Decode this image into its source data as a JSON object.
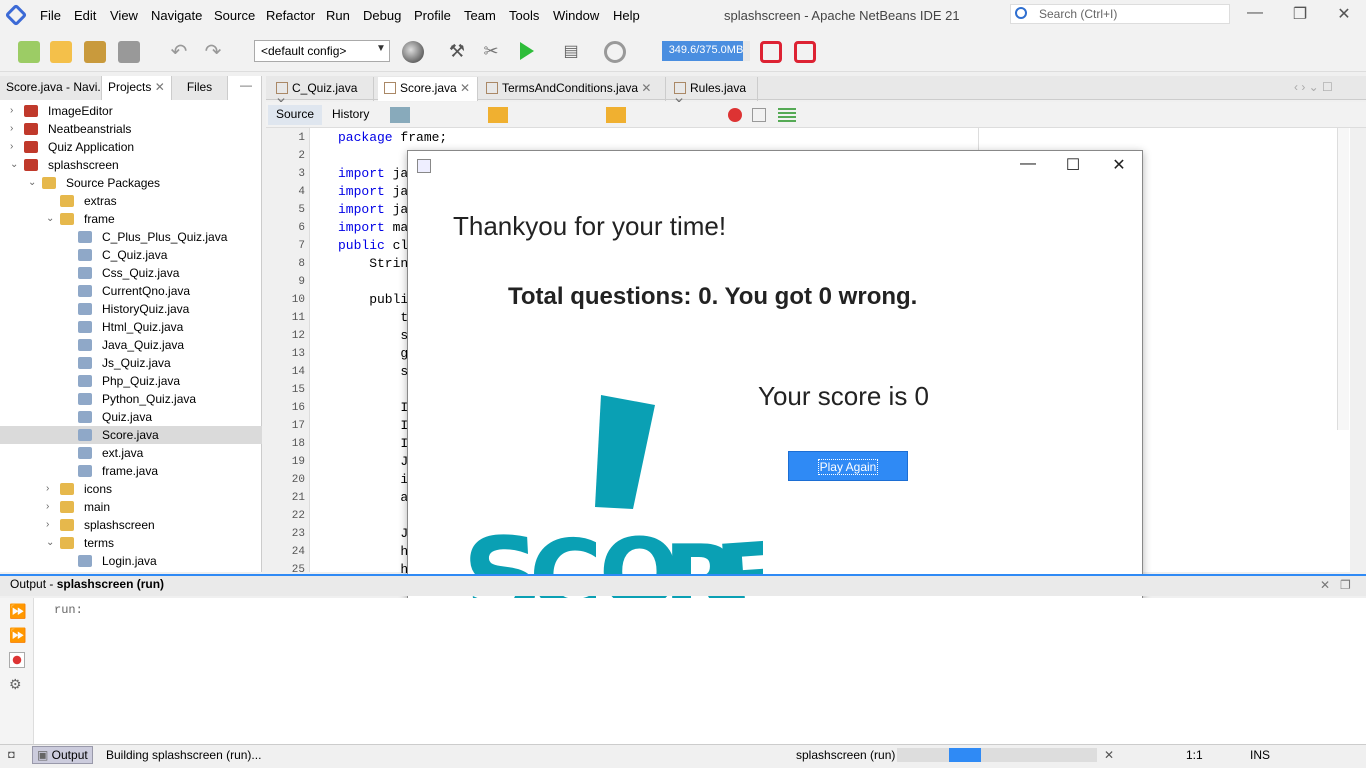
{
  "menubar": {
    "items": [
      "File",
      "Edit",
      "View",
      "Navigate",
      "Source",
      "Refactor",
      "Run",
      "Debug",
      "Profile",
      "Team",
      "Tools",
      "Window",
      "Help"
    ],
    "title": "splashscreen - Apache NetBeans IDE 21",
    "search_placeholder": "Search (Ctrl+I)"
  },
  "toolbar": {
    "config": "<default config>",
    "memory": "349.6/375.0MB"
  },
  "left_panel": {
    "tabs": [
      "Score.java - Navi...",
      "Projects",
      "Files"
    ],
    "tree": [
      {
        "label": "ImageEditor",
        "depth": 0,
        "icon": "project-icon",
        "arrow": ">"
      },
      {
        "label": "Neatbeanstrials",
        "depth": 0,
        "icon": "project-icon",
        "arrow": ">"
      },
      {
        "label": "Quiz Application",
        "depth": 0,
        "icon": "project-icon",
        "arrow": ">"
      },
      {
        "label": "splashscreen",
        "depth": 0,
        "icon": "project-icon",
        "arrow": "v"
      },
      {
        "label": "Source Packages",
        "depth": 1,
        "icon": "source-packages-icon",
        "arrow": "v"
      },
      {
        "label": "extras",
        "depth": 2,
        "icon": "package-icon",
        "arrow": ""
      },
      {
        "label": "frame",
        "depth": 2,
        "icon": "package-icon",
        "arrow": "v"
      },
      {
        "label": "C_Plus_Plus_Quiz.java",
        "depth": 3,
        "icon": "java-file-icon",
        "arrow": ""
      },
      {
        "label": "C_Quiz.java",
        "depth": 3,
        "icon": "java-file-icon",
        "arrow": ""
      },
      {
        "label": "Css_Quiz.java",
        "depth": 3,
        "icon": "java-file-icon",
        "arrow": ""
      },
      {
        "label": "CurrentQno.java",
        "depth": 3,
        "icon": "java-file-icon",
        "arrow": ""
      },
      {
        "label": "HistoryQuiz.java",
        "depth": 3,
        "icon": "java-file-icon",
        "arrow": ""
      },
      {
        "label": "Html_Quiz.java",
        "depth": 3,
        "icon": "java-file-icon",
        "arrow": ""
      },
      {
        "label": "Java_Quiz.java",
        "depth": 3,
        "icon": "java-file-icon",
        "arrow": ""
      },
      {
        "label": "Js_Quiz.java",
        "depth": 3,
        "icon": "java-file-icon",
        "arrow": ""
      },
      {
        "label": "Php_Quiz.java",
        "depth": 3,
        "icon": "java-file-icon",
        "arrow": ""
      },
      {
        "label": "Python_Quiz.java",
        "depth": 3,
        "icon": "java-file-icon",
        "arrow": ""
      },
      {
        "label": "Quiz.java",
        "depth": 3,
        "icon": "java-file-icon",
        "arrow": ""
      },
      {
        "label": "Score.java",
        "depth": 3,
        "icon": "java-file-icon",
        "arrow": "",
        "selected": true
      },
      {
        "label": "ext.java",
        "depth": 3,
        "icon": "java-file-icon",
        "arrow": ""
      },
      {
        "label": "frame.java",
        "depth": 3,
        "icon": "java-file-icon",
        "arrow": ""
      },
      {
        "label": "icons",
        "depth": 2,
        "icon": "package-icon",
        "arrow": ">"
      },
      {
        "label": "main",
        "depth": 2,
        "icon": "package-icon",
        "arrow": ">"
      },
      {
        "label": "splashscreen",
        "depth": 2,
        "icon": "package-icon",
        "arrow": ">"
      },
      {
        "label": "terms",
        "depth": 2,
        "icon": "package-icon",
        "arrow": "v"
      },
      {
        "label": "Login.java",
        "depth": 3,
        "icon": "java-file-icon",
        "arrow": ""
      }
    ]
  },
  "editor": {
    "tabs": [
      "C_Quiz.java",
      "Score.java",
      "TermsAndConditions.java",
      "Rules.java"
    ],
    "source_label": "Source",
    "history_label": "History",
    "line_numbers": [
      "1",
      "2",
      "3",
      "4",
      "5",
      "6",
      "7",
      "8",
      "9",
      "10",
      "11",
      "12",
      "13",
      "14",
      "15",
      "16",
      "17",
      "18",
      "19",
      "20",
      "21",
      "22",
      "23",
      "24",
      "25"
    ],
    "lines": [
      {
        "kw": "package",
        "rest": " frame;"
      },
      {
        "kw": "",
        "rest": ""
      },
      {
        "kw": "import",
        "rest": " ja"
      },
      {
        "kw": "import",
        "rest": " ja"
      },
      {
        "kw": "import",
        "rest": " ja"
      },
      {
        "kw": "import",
        "rest": " ma"
      },
      {
        "kw": "public",
        "rest": " cl"
      },
      {
        "kw": "",
        "rest": "    Strin"
      },
      {
        "kw": "",
        "rest": ""
      },
      {
        "kw": "",
        "rest": "    publi"
      },
      {
        "kw": "",
        "rest": "        t"
      },
      {
        "kw": "",
        "rest": "        s"
      },
      {
        "kw": "",
        "rest": "        g"
      },
      {
        "kw": "",
        "rest": "        s"
      },
      {
        "kw": "",
        "rest": ""
      },
      {
        "kw": "",
        "rest": "        I"
      },
      {
        "kw": "",
        "rest": "        I"
      },
      {
        "kw": "",
        "rest": "        I"
      },
      {
        "kw": "",
        "rest": "        J"
      },
      {
        "kw": "",
        "rest": "        i"
      },
      {
        "kw": "",
        "rest": "        a"
      },
      {
        "kw": "",
        "rest": ""
      },
      {
        "kw": "",
        "rest": "        J"
      },
      {
        "kw": "",
        "rest": "        h"
      },
      {
        "kw": "",
        "rest": "        h"
      }
    ]
  },
  "dialog": {
    "thanks": "Thankyou  for your time!",
    "total": "Total questions: 0. You got 0 wrong.",
    "your_score": "Your score is 0",
    "play_again": "Play Again",
    "logo_text": "SCORE"
  },
  "output": {
    "title": "Output - ",
    "title_bold": "splashscreen (run)",
    "run_text": "run:"
  },
  "statusbar": {
    "output_tab": "Output",
    "building": "Building splashscreen (run)...",
    "task": "splashscreen (run)",
    "position": "1:1",
    "mode": "INS"
  },
  "colors": {
    "accent": "#2f8af5",
    "logo": "#0aa0b4",
    "keyword": "#0000e6"
  }
}
